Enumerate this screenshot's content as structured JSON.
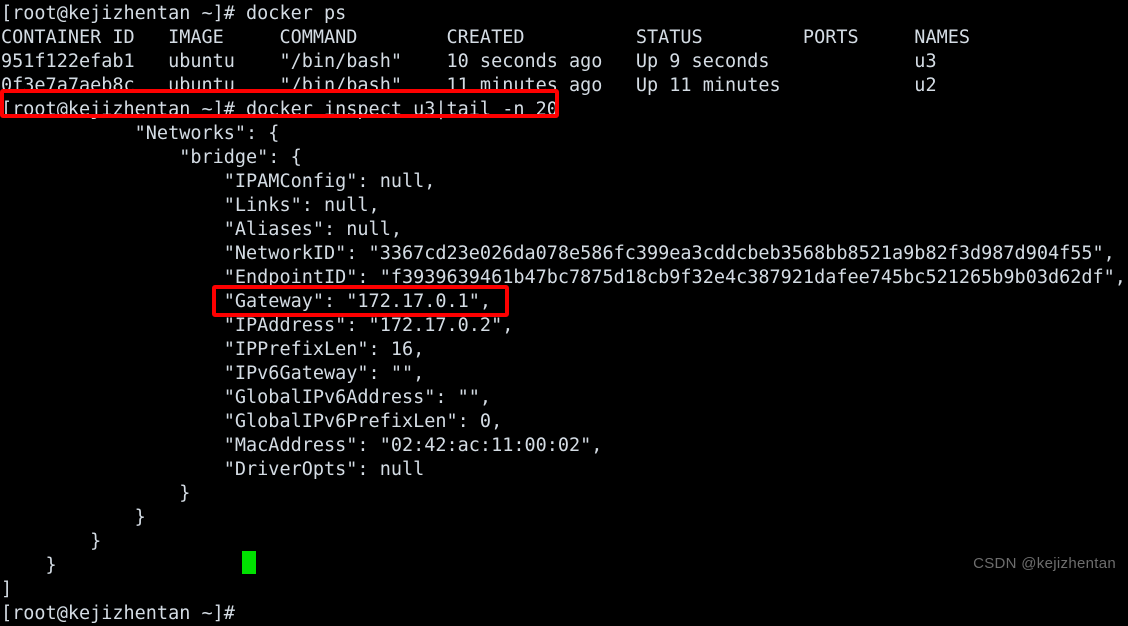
{
  "terminal": {
    "colors": {
      "background": "#000000",
      "foreground": "#d4dce4",
      "highlight_box": "#fe0000",
      "cursor": "#00e000",
      "watermark": "#6d6d6d"
    },
    "lines": [
      "[root@kejizhentan ~]# docker ps",
      "CONTAINER ID   IMAGE     COMMAND        CREATED          STATUS         PORTS     NAMES",
      "951f122efab1   ubuntu    \"/bin/bash\"    10 seconds ago   Up 9 seconds             u3",
      "0f3e7a7aeb8c   ubuntu    \"/bin/bash\"    11 minutes ago   Up 11 minutes            u2",
      "[root@kejizhentan ~]# docker inspect u3|tail -n 20",
      "            \"Networks\": {",
      "                \"bridge\": {",
      "                    \"IPAMConfig\": null,",
      "                    \"Links\": null,",
      "                    \"Aliases\": null,",
      "                    \"NetworkID\": \"3367cd23e026da078e586fc399ea3cddcbeb3568bb8521a9b82f3d987d904f55\",",
      "                    \"EndpointID\": \"f3939639461b47bc7875d18cb9f32e4c387921dafee745bc521265b9b03d62df\",",
      "                    \"Gateway\": \"172.17.0.1\",",
      "                    \"IPAddress\": \"172.17.0.2\",",
      "                    \"IPPrefixLen\": 16,",
      "                    \"IPv6Gateway\": \"\",",
      "                    \"GlobalIPv6Address\": \"\",",
      "                    \"GlobalIPv6PrefixLen\": 0,",
      "                    \"MacAddress\": \"02:42:ac:11:00:02\",",
      "                    \"DriverOpts\": null",
      "                }",
      "            }",
      "        }",
      "    }",
      "]",
      "[root@kejizhentan ~]# "
    ],
    "commands": {
      "first": "docker ps",
      "second": "docker inspect u3|tail -n 20",
      "prompt": "[root@kejizhentan ~]#"
    },
    "ps_table": {
      "headers": [
        "CONTAINER ID",
        "IMAGE",
        "COMMAND",
        "CREATED",
        "STATUS",
        "PORTS",
        "NAMES"
      ],
      "rows": [
        [
          "951f122efab1",
          "ubuntu",
          "\"/bin/bash\"",
          "10 seconds ago",
          "Up 9 seconds",
          "",
          "u3"
        ],
        [
          "0f3e7a7aeb8c",
          "ubuntu",
          "\"/bin/bash\"",
          "11 minutes ago",
          "Up 11 minutes",
          "",
          "u2"
        ]
      ]
    },
    "inspect_fields": {
      "Networks": "bridge",
      "IPAMConfig": "null",
      "Links": "null",
      "Aliases": "null",
      "NetworkID": "3367cd23e026da078e586fc399ea3cddcbeb3568bb8521a9b82f3d987d904f55",
      "EndpointID": "f3939639461b47bc7875d18cb9f32e4c387921dafee745bc521265b9b03d62df",
      "Gateway": "172.17.0.1",
      "IPAddress": "172.17.0.2",
      "IPPrefixLen": "16",
      "IPv6Gateway": "",
      "GlobalIPv6Address": "",
      "GlobalIPv6PrefixLen": "0",
      "MacAddress": "02:42:ac:11:00:02",
      "DriverOpts": "null"
    }
  },
  "watermark": {
    "text": "CSDN @kejizhentan"
  }
}
